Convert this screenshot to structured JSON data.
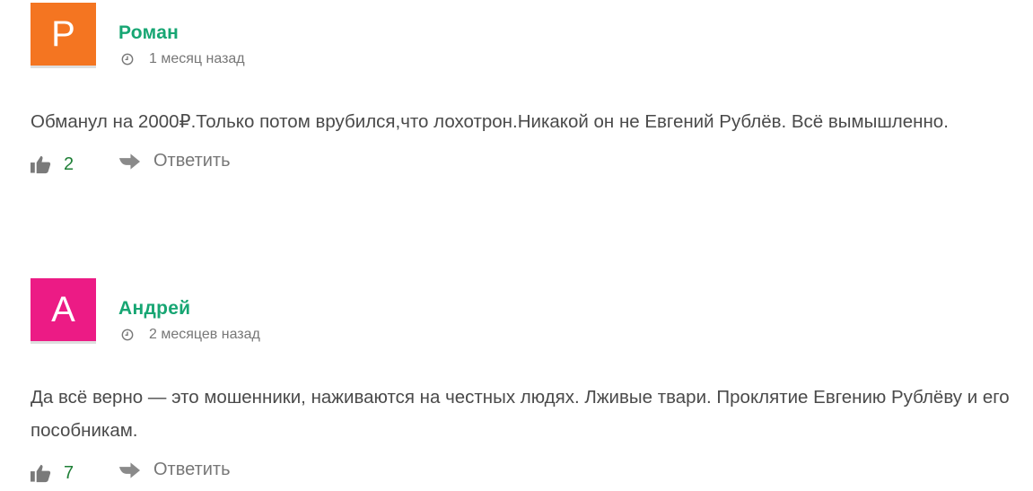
{
  "comments": [
    {
      "avatar_letter": "Р",
      "avatar_color": "#f47521",
      "author": "Роман",
      "time": "1 месяц назад",
      "text": "Обманул на 2000₽.Только потом врубился,что лохотрон.Никакой он не Евгений Рублёв. Всё вымышленно.",
      "likes": "2",
      "reply_label": "Ответить"
    },
    {
      "avatar_letter": "А",
      "avatar_color": "#ec1b85",
      "author": "Андрей",
      "time": "2 месяцев назад",
      "text": "Да всё верно — это мошенники, наживаются на честных людях. Лживые твари. Проклятие Евгению Рублёву и его пособникам.",
      "likes": "7",
      "reply_label": "Ответить"
    }
  ],
  "icons": {
    "clock": "clock-icon",
    "like": "thumbs-up-icon",
    "reply": "reply-arrow-icon"
  },
  "colors": {
    "author": "#17a673",
    "likes": "#1e7f36",
    "muted": "#777777"
  }
}
